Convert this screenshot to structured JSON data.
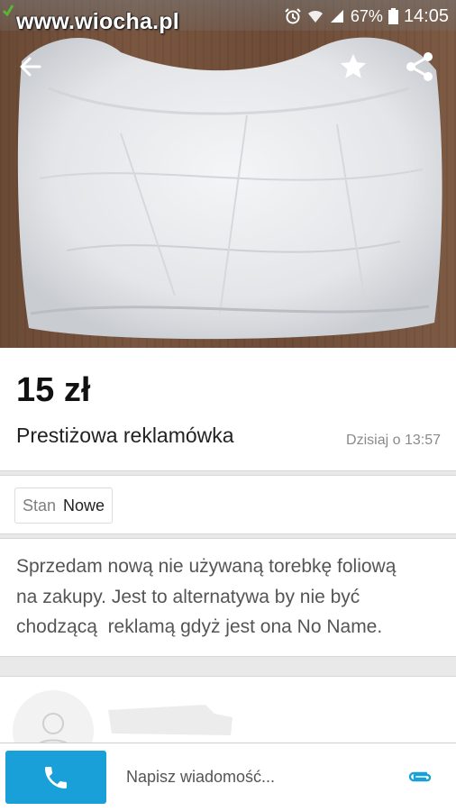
{
  "status_bar": {
    "watermark": "www.wiocha.pl",
    "battery": "67%",
    "time": "14:05"
  },
  "toolbar": {
    "back_icon": "back-arrow-icon",
    "favorite_icon": "star-icon",
    "share_icon": "share-icon"
  },
  "listing": {
    "price": "15 zł",
    "title": "Prestiżowa reklamówka",
    "date": "Dzisiaj o 13:57",
    "params": [
      {
        "key": "Stan",
        "value": "Nowe"
      }
    ],
    "description": "Sprzedam nową nie używaną torebkę foliową\nna zakupy. Jest to alternatywa by nie być\nchodzącą  reklamą gdyż jest ona No Name."
  },
  "bottom_bar": {
    "call_icon": "phone-icon",
    "message_placeholder": "Napisz wiadomość...",
    "attach_icon": "paperclip-icon"
  },
  "colors": {
    "accent": "#1aa0d8",
    "text_dark": "#111111",
    "text_muted": "#8a8a8a"
  }
}
